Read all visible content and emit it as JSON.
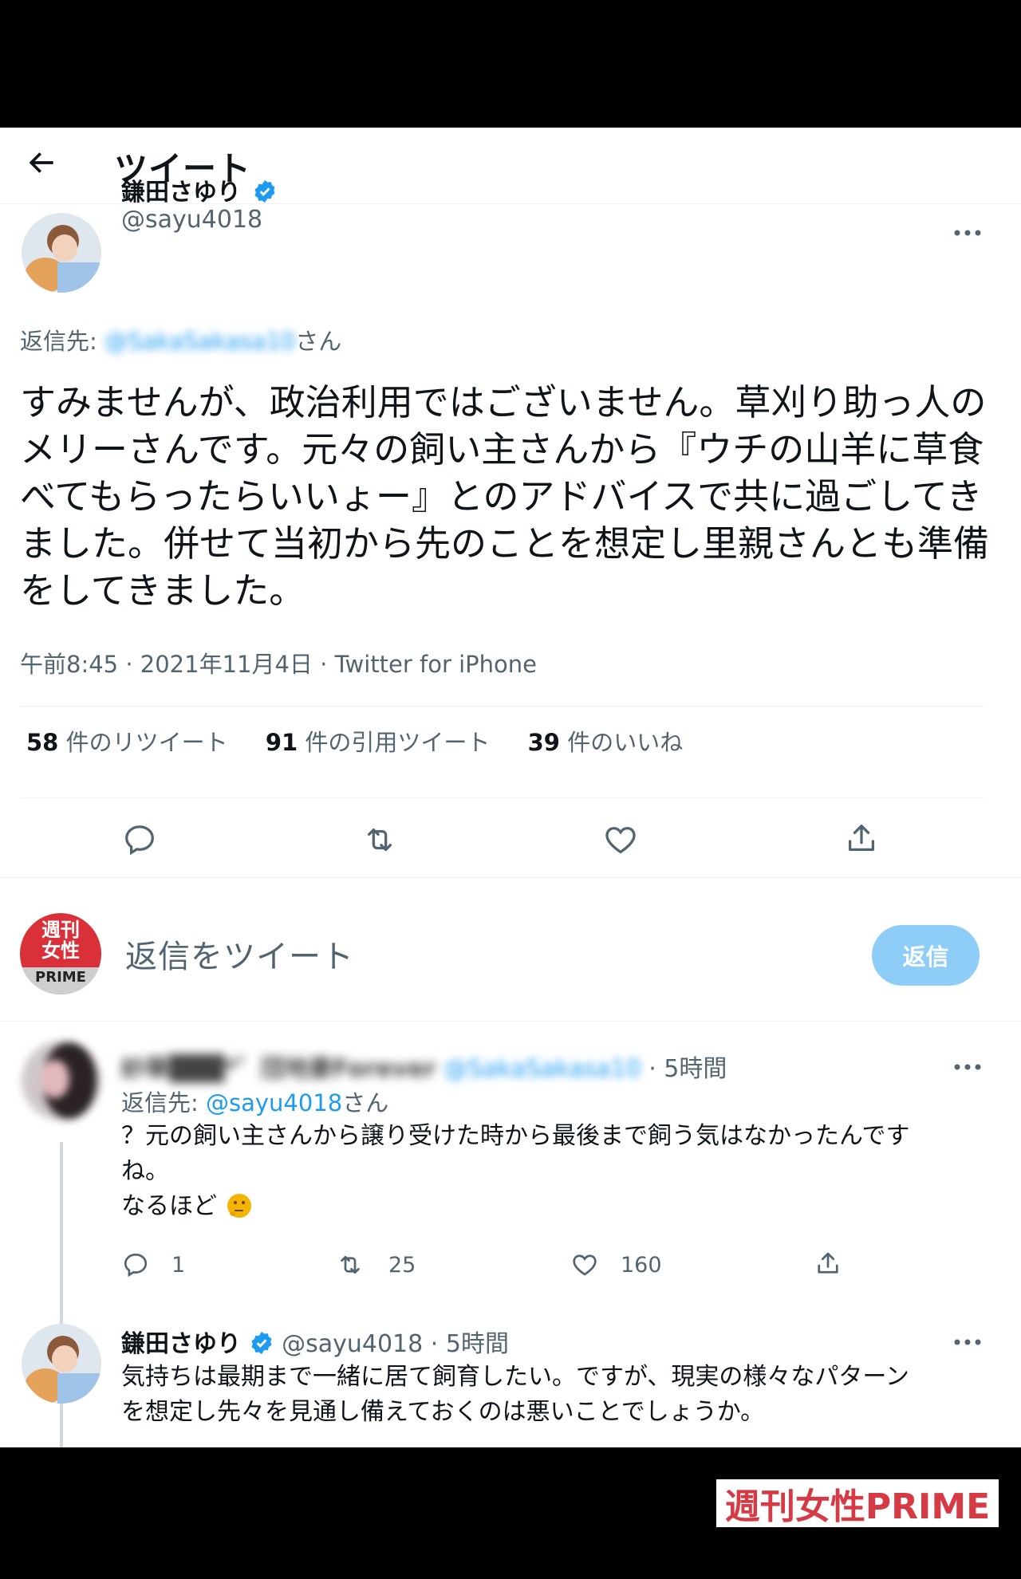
{
  "header": {
    "title": "ツイート"
  },
  "tweet": {
    "author_name": "鎌田さゆり",
    "author_handle": "@sayu4018",
    "reply_to_label": "返信先:",
    "reply_to_handle": "@SakaSakasa10",
    "reply_to_suffix": "さん",
    "text": "すみませんが、政治利用ではございません。草刈り助っ人のメリーさんです。元々の飼い主さんから『ウチの山羊に草食べてもらったらいいょー』とのアドバイスで共に過ごしてきました。併せて当初から先のことを想定し里親さんとも準備をしてきました。",
    "meta": "午前8:45 · 2021年11月4日 · Twitter for iPhone",
    "stats": {
      "retweets_count": "58",
      "retweets_label": "件のリツイート",
      "quotes_count": "91",
      "quotes_label": "件の引用ツイート",
      "likes_count": "39",
      "likes_label": "件のいいね"
    }
  },
  "compose": {
    "avatar_text_top": "週刊",
    "avatar_text_mid": "女性",
    "avatar_text_bottom": "PRIME",
    "placeholder": "返信をツイート",
    "button_label": "返信"
  },
  "reply1": {
    "name": "紗華███*゜団地妻Forever",
    "handle": "@SakaSakasa10",
    "time": "· 5時間",
    "reply_to_label": "返信先:",
    "reply_to_handle": "@sayu4018",
    "reply_to_suffix": "さん",
    "text_line1": "？元の飼い主さんから譲り受けた時から最後まで飼う気はなかったんです",
    "text_line2": "ね。",
    "text_line3": "なるほど",
    "reply_count": "1",
    "retweet_count": "25",
    "like_count": "160"
  },
  "reply2": {
    "name": "鎌田さゆり",
    "handle": "@sayu4018",
    "time": "· 5時間",
    "text_line1": "気持ちは最期まで一緒に居て飼育したい。ですが、現実の様々なパターン",
    "text_line2": "を想定し先々を見通し備えておくのは悪いことでしょうか。"
  },
  "watermark": {
    "text": "週刊女性PRIME"
  },
  "colors": {
    "accent": "#1d9bf0",
    "reply_button": "#8ecdf8",
    "watermark": "#d63a44"
  }
}
